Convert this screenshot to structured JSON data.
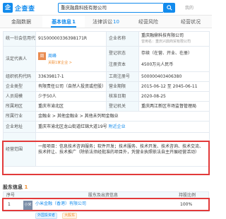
{
  "header": {
    "logo_mark": "企",
    "logo_text": "企查查",
    "search_value": "重庆融鼎科技有限公司",
    "right_text": "我的"
  },
  "tabs": [
    {
      "label": "基本信息",
      "count": "1",
      "active": true
    },
    {
      "label": "法律诉讼",
      "count": "10",
      "active": false
    },
    {
      "label": "经营风险",
      "count": "",
      "active": false
    },
    {
      "label": "经营状况",
      "count": "",
      "active": false
    }
  ],
  "tabs_left": {
    "label": "金融数据"
  },
  "info": {
    "credit_code_label": "统一社会信用代码",
    "credit_code": "91500000336398171R",
    "company_name_label": "企业名称",
    "company_name": "重庆融鼎科技有限公司",
    "company_name_sub": "曾用名：重庆兴鼎商贸有限公司",
    "legal_label": "法定代表人",
    "legal_avatar": "周",
    "legal_name": "周峰",
    "legal_sub": "关联1家企业 >",
    "status_label": "登记状态",
    "status": "存续（在营、开业、在册）",
    "capital_label": "注册资本",
    "capital": "4500万元人民币",
    "org_code_label": "组织机构代码",
    "org_code": "33639817-1",
    "reg_no_label": "工商注册号",
    "reg_no": "500000403406380",
    "type_label": "企业类型",
    "type": "有限责任公司（自然人投资或控股）",
    "term_label": "营业期限",
    "term": "2015-06-12 至 2045-06-11",
    "staff_label": "人员规模",
    "staff": "少于50人",
    "approve_label": "核准日期",
    "approve": "2020-08-25",
    "region_label": "所属地区",
    "region": "重庆市渝北区",
    "authority_label": "登记机关",
    "authority": "重庆两江新区市场监督管理局",
    "industry_label": "所属行业",
    "industry": "金融业 > 其他金融业 > 其他未列明金融业",
    "address_label": "企业地址",
    "address": "重庆市渝北区龙山街道红锦大道19号",
    "nearby": "附近企业",
    "scope_label": "经营范围",
    "scope": "一般项目：信息技术咨询服务；软件开发；技术服务、技术开发、技术咨询、技术交流、技术转让、技术推广（除依法须经批准的项目外，凭营业执照依法自主开展经营活动）"
  },
  "shareholders": {
    "title": "股东信息",
    "count": "1",
    "col_no": "序号",
    "col_name": "股东及出资信息",
    "col_ratio": "持股比例",
    "rows": [
      {
        "no": "1",
        "avatar": "小米",
        "name": "小米金融（香港）有限公司",
        "tags": [
          "外国投资者",
          "大股东"
        ],
        "ratio": "100%"
      }
    ]
  }
}
